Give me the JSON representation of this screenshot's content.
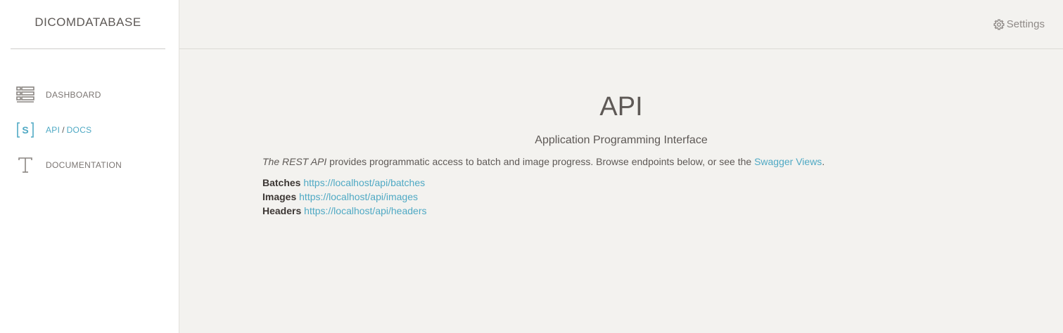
{
  "brand": {
    "title": "DICOMDATABASE"
  },
  "sidebar": {
    "items": [
      {
        "label": "DASHBOARD",
        "icon": "dashboard-list-icon"
      },
      {
        "label_api": "API",
        "separator": "/",
        "label_docs": "DOCS",
        "icon": "swagger-bracket-icon",
        "active": true
      },
      {
        "label": "DOCUMENTATION",
        "icon": "text-t-icon"
      }
    ]
  },
  "header": {
    "settings_label": "Settings",
    "settings_icon": "gear-icon"
  },
  "main": {
    "title": "API",
    "subtitle": "Application Programming Interface",
    "intro_em": "The REST API",
    "intro_text": " provides programmatic access to batch and image progress. Browse endpoints below, or see the ",
    "intro_link": "Swagger Views",
    "intro_end": ".",
    "endpoints": [
      {
        "name": "Batches",
        "url": "https://localhost/api/batches"
      },
      {
        "name": "Images",
        "url": "https://localhost/api/images"
      },
      {
        "name": "Headers",
        "url": "https://localhost/api/headers"
      }
    ]
  },
  "colors": {
    "accent": "#4fa9c4",
    "background": "#f3f2ef",
    "sidebar": "#ffffff",
    "text": "#5e5956"
  }
}
